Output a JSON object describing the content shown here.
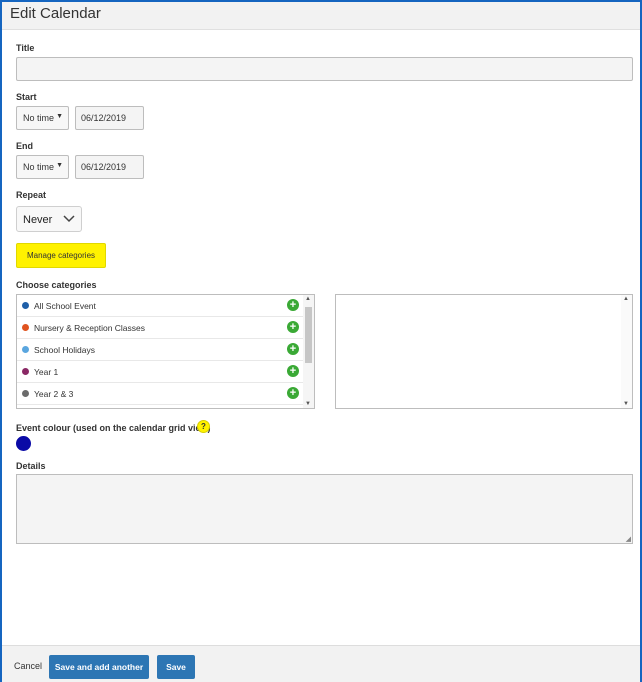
{
  "header": {
    "title": "Edit Calendar"
  },
  "form": {
    "title_label": "Title",
    "title_value": "",
    "start_label": "Start",
    "start_time": "No time",
    "start_date": "06/12/2019",
    "end_label": "End",
    "end_time": "No time",
    "end_date": "06/12/2019",
    "repeat_label": "Repeat",
    "repeat_value": "Never",
    "manage_label": "Manage categories",
    "choose_label": "Choose categories",
    "categories": [
      {
        "name": "All School Event",
        "color": "#1f5fa8"
      },
      {
        "name": "Nursery & Reception Classes",
        "color": "#e0531f"
      },
      {
        "name": "School Holidays",
        "color": "#5aa6df"
      },
      {
        "name": "Year 1",
        "color": "#8a2865"
      },
      {
        "name": "Year 2 & 3",
        "color": "#6b6b6b"
      }
    ],
    "colour_label": "Event colour (used on the calendar grid view)",
    "help_glyph": "?",
    "event_colour": "#0a0aa6",
    "details_label": "Details",
    "details_value": ""
  },
  "footer": {
    "cancel_label": "Cancel",
    "save_another_label": "Save and add another",
    "save_label": "Save"
  },
  "colors": {
    "accent": "#2d76b4",
    "highlight": "#fff200",
    "add": "#3aa935"
  }
}
